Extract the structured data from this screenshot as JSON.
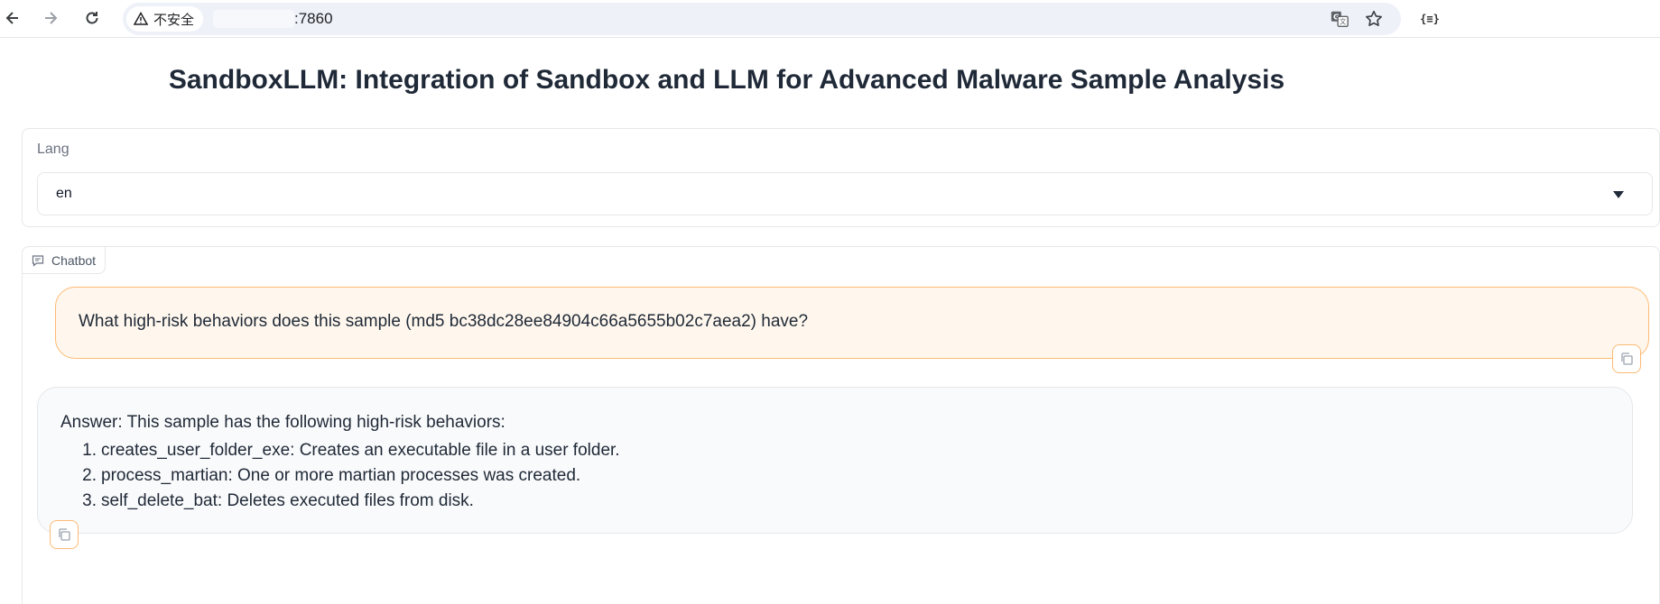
{
  "browser": {
    "security_label": "不安全",
    "url": ":7860",
    "icons": {
      "back": "back-arrow-icon",
      "forward": "forward-arrow-icon",
      "reload": "reload-icon",
      "warning": "warning-triangle-icon",
      "translate": "translate-icon",
      "bookmark": "star-icon",
      "extension": "json-extension-icon"
    },
    "extension_glyph": "{≡}"
  },
  "page": {
    "title": "SandboxLLM: Integration of Sandbox and LLM for Advanced Malware Sample Analysis"
  },
  "lang": {
    "label": "Lang",
    "selected": "en"
  },
  "chatbot": {
    "tab_label": "Chatbot",
    "messages": [
      {
        "role": "user",
        "text": "What high-risk behaviors does this sample (md5 bc38dc28ee84904c66a5655b02c7aea2) have?"
      },
      {
        "role": "bot",
        "intro": "Answer: This sample has the following high-risk behaviors:",
        "items": [
          {
            "num": "1.",
            "text": "creates_user_folder_exe: Creates an executable file in a user folder."
          },
          {
            "num": "2.",
            "text": "process_martian: One or more martian processes was created."
          },
          {
            "num": "3.",
            "text": "self_delete_bat: Deletes executed files from disk."
          }
        ]
      }
    ]
  },
  "colors": {
    "user_bubble_bg": "#fff7ed",
    "user_bubble_border": "#fdba74",
    "bot_bubble_bg": "#f9fafb",
    "title_text": "#1f2937"
  }
}
